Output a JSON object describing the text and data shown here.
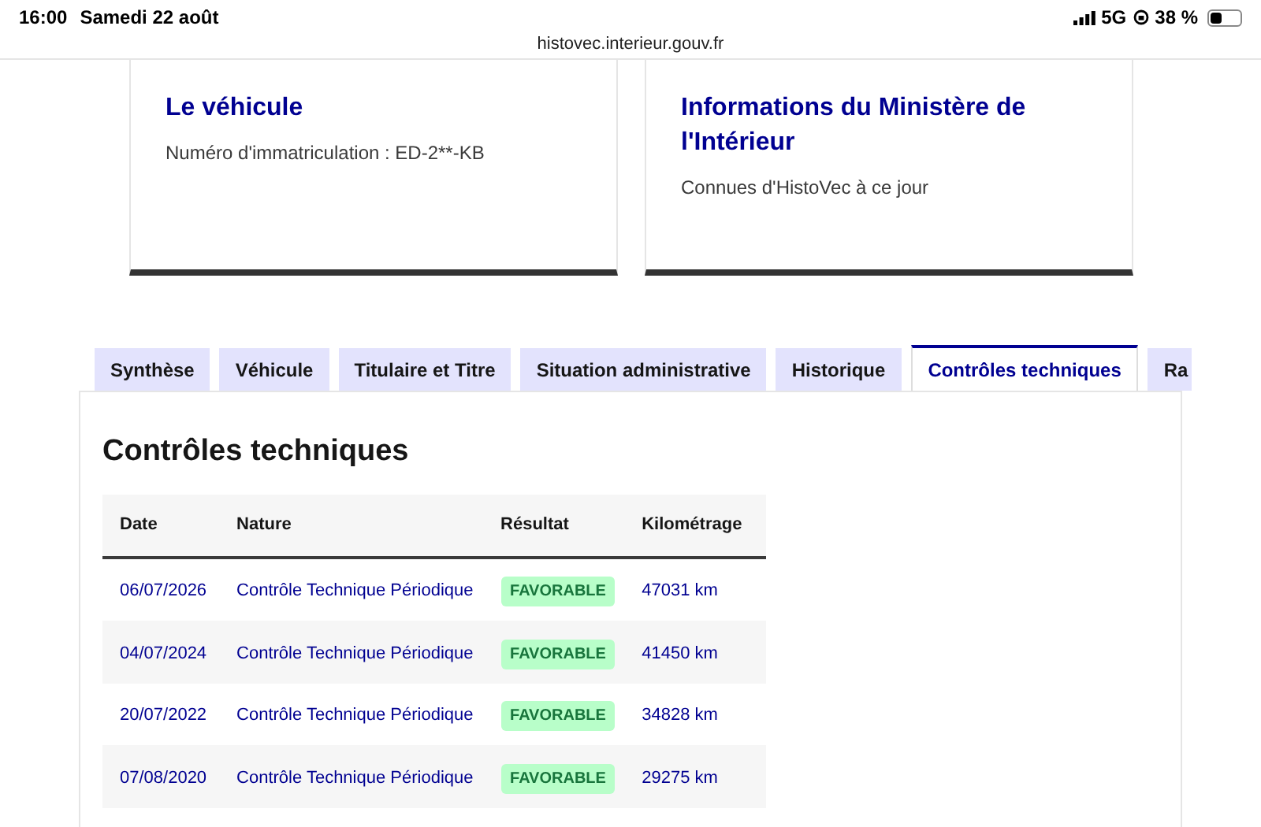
{
  "status_bar": {
    "time": "16:00",
    "date": "Samedi 22 août",
    "network": "5G",
    "battery": "38 %"
  },
  "address_bar": {
    "url": "histovec.interieur.gouv.fr"
  },
  "cards": [
    {
      "title": "Le véhicule",
      "text": "Numéro d'immatriculation : ED-2**-KB"
    },
    {
      "title": "Informations du Ministère de l'Intérieur",
      "text": "Connues d'HistoVec à ce jour"
    }
  ],
  "tabs": [
    {
      "label": "Synthèse",
      "selected": false
    },
    {
      "label": "Véhicule",
      "selected": false
    },
    {
      "label": "Titulaire et Titre",
      "selected": false
    },
    {
      "label": "Situation administrative",
      "selected": false
    },
    {
      "label": "Historique",
      "selected": false
    },
    {
      "label": "Contrôles techniques",
      "selected": true
    },
    {
      "label": "Ra",
      "selected": false
    }
  ],
  "panel": {
    "title": "Contrôles techniques",
    "table": {
      "columns": [
        "Date",
        "Nature",
        "Résultat",
        "Kilométrage"
      ],
      "rows": [
        {
          "date": "06/07/2026",
          "nature": "Contrôle Technique Périodique",
          "result": "FAVORABLE",
          "mileage": "47031 km"
        },
        {
          "date": "04/07/2024",
          "nature": "Contrôle Technique Périodique",
          "result": "FAVORABLE",
          "mileage": "41450 km"
        },
        {
          "date": "20/07/2022",
          "nature": "Contrôle Technique Périodique",
          "result": "FAVORABLE",
          "mileage": "34828 km"
        },
        {
          "date": "07/08/2020",
          "nature": "Contrôle Technique Périodique",
          "result": "FAVORABLE",
          "mileage": "29275 km"
        }
      ]
    }
  }
}
